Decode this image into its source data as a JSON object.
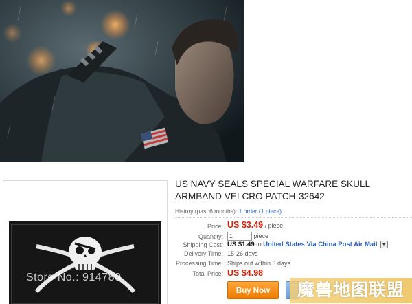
{
  "product": {
    "title": "US NAVY SEALS SPECIAL WARFARE SKULL ARMBAND VELCRO PATCH-32642",
    "history_label": "History (past 6 months):",
    "history_value": "1 order (1 piece)"
  },
  "details": {
    "price_label": "Price:",
    "price_value": "US $3.49",
    "price_unit": "/ piece",
    "quantity_label": "Quantity:",
    "quantity_value": "1",
    "quantity_unit": "piece",
    "shipping_cost_label": "Shipping Cost:",
    "shipping_cost_value": "US $1.49",
    "shipping_to": "to",
    "shipping_method": "United States Via China Post Air Mail",
    "delivery_label": "Delivery Time:",
    "delivery_value": "15-26 days",
    "processing_label": "Processing Time:",
    "processing_value": "Ships out within 3 days",
    "total_label": "Total Price:",
    "total_value": "US $4.98"
  },
  "actions": {
    "buy_now": "Buy Now"
  },
  "thumbnail": {
    "watermark": "Store No.: 914780"
  },
  "overlay": {
    "site_mark": "魔兽地图联盟"
  },
  "colors": {
    "price_red": "#d81e06",
    "link_blue": "#2b63c0",
    "buy_orange": "#f08a12"
  },
  "icons": {
    "shipping_dropdown": "chevron-down-icon",
    "cart": "cart-icon"
  }
}
